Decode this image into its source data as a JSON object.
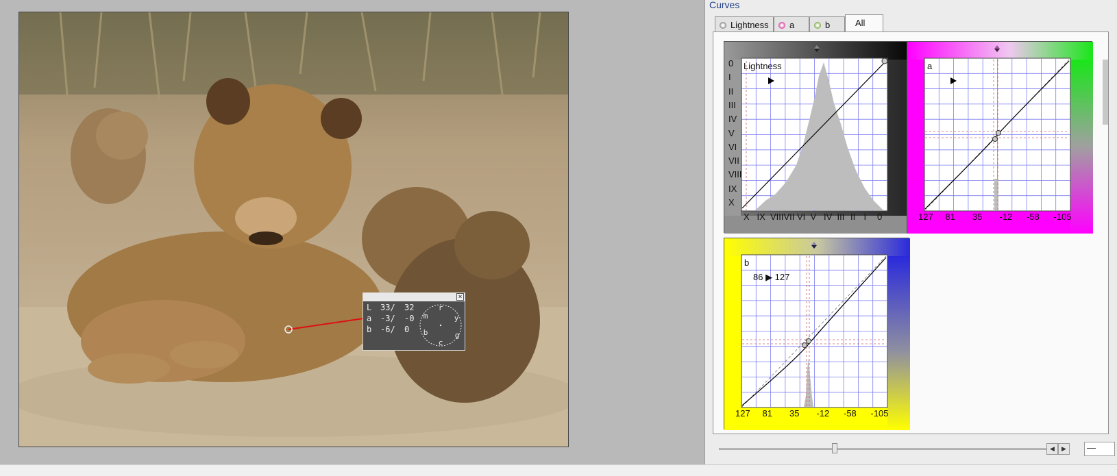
{
  "dialog": {
    "title": "Curves"
  },
  "tabs": [
    {
      "label": "Lightness",
      "icon": "lightness-icon",
      "color": "#777777"
    },
    {
      "label": "a",
      "icon": "a-channel-icon",
      "color": "#c6388d"
    },
    {
      "label": "b",
      "icon": "b-channel-icon",
      "color": "#7aa83a"
    },
    {
      "label": "All"
    }
  ],
  "probe": {
    "rows": [
      {
        "ch": "L",
        "before": "33/",
        "after": "32"
      },
      {
        "ch": "a",
        "before": "-3/",
        "after": "-0"
      },
      {
        "ch": "b",
        "before": "-6/",
        "after": "0"
      }
    ],
    "wheel_labels": {
      "top": "r",
      "right": "y",
      "bottom": "c",
      "left": "b",
      "top_left": "m",
      "bottom_right": "g"
    },
    "close_glyph": "×"
  },
  "curves": {
    "lightness": {
      "title": "Lightness",
      "frame_colors": {
        "left": "#6f6f6f",
        "right": "#2e2e2e",
        "top": "#101010"
      },
      "y_zones": [
        "0",
        "I",
        "II",
        "III",
        "IV",
        "V",
        "VI",
        "VII",
        "VIII",
        "IX",
        "X"
      ],
      "x_zones": [
        "X",
        "IX",
        "VIII",
        "VII",
        "VI",
        "V",
        "IV",
        "III",
        "II",
        "I",
        "0"
      ]
    },
    "a": {
      "title": "a",
      "frame_colors": {
        "left": "#ff00ff",
        "right": "#19e619"
      },
      "x_ticks": [
        "127",
        "81",
        "35",
        "-12",
        "-58",
        "-105"
      ]
    },
    "b": {
      "title": "b",
      "marker": "86 ▶ 127",
      "frame_colors": {
        "left": "#ffff00",
        "right": "#2a2adc"
      },
      "x_ticks": [
        "127",
        "81",
        "35",
        "-12",
        "-58",
        "-105"
      ]
    }
  },
  "slider": {
    "value_text": "—",
    "prev": "◀",
    "next": "▶"
  },
  "colors": {
    "grid": "#7d7df0",
    "curve": "#000000",
    "histogram": "#bdbdbd",
    "probe_line": "#dd1010",
    "title": "#1f3f86"
  }
}
